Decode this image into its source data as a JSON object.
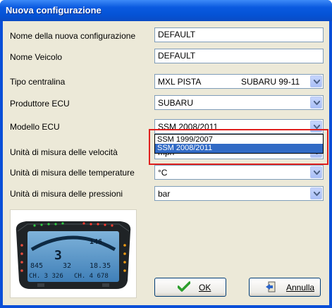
{
  "window": {
    "title": "Nuova configurazione"
  },
  "fields": {
    "nome_config": {
      "label": "Nome della nuova configurazione",
      "value": "DEFAULT"
    },
    "nome_veicolo": {
      "label": "Nome Veicolo",
      "value": "DEFAULT"
    },
    "tipo_centralina": {
      "label": "Tipo centralina",
      "value": "MXL PISTA",
      "value2": "SUBARU 99-11"
    },
    "produttore_ecu": {
      "label": "Produttore ECU",
      "value": "SUBARU"
    },
    "modello_ecu": {
      "label": "Modello ECU",
      "value": "SSM 2008/2011"
    },
    "unita_velocita": {
      "label": "Unità di misura delle velocità",
      "value": "mph"
    },
    "unita_temperature": {
      "label": "Unità di misura delle temperature",
      "value": "°C"
    },
    "unita_pressioni": {
      "label": "Unità di misura delle pressioni",
      "value": "bar"
    }
  },
  "dropdown": {
    "options": [
      "SSM 1999/2007",
      "SSM 2008/2011"
    ],
    "selected_index": 1
  },
  "dash_display": {
    "big": "3",
    "top_right": "146",
    "mid_left": "845",
    "mid_center": "32",
    "mid_right": "18.35",
    "bottom_left": "CH. 3 326",
    "bottom_right": "CH. 4 678"
  },
  "buttons": {
    "ok": "OK",
    "cancel": "Annulla"
  },
  "colors": {
    "title_bar": "#0a5ae0",
    "dialog_bg": "#ece9d8",
    "selection": "#316ac5",
    "highlight": "#e0201e"
  }
}
